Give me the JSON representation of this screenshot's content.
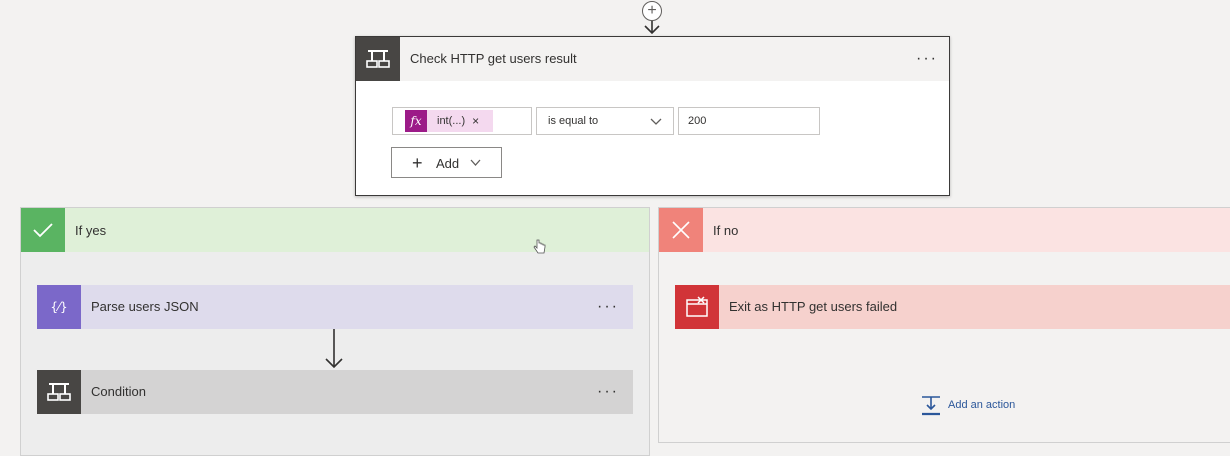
{
  "connector": {
    "plus_glyph": "+",
    "icon": "plus-circle-icon"
  },
  "condition_card": {
    "title": "Check HTTP get users result",
    "more_label": "···",
    "expression": {
      "fx_label": "fx",
      "token_text": "int(...)",
      "remove_label": "×"
    },
    "operator": {
      "selected": "is equal to"
    },
    "value": "200",
    "add_button": {
      "plus": "+",
      "label": "Add"
    }
  },
  "branches": {
    "yes": {
      "title": "If yes",
      "actions": [
        {
          "title": "Parse users JSON",
          "more_label": "···",
          "icon": "parse-json-icon",
          "color": "#7b68c9"
        },
        {
          "title": "Condition",
          "more_label": "···",
          "icon": "condition-icon",
          "color": "#484644"
        }
      ]
    },
    "no": {
      "title": "If no",
      "actions": [
        {
          "title": "Exit as HTTP get users failed",
          "icon": "terminate-icon",
          "color": "#d13438"
        }
      ],
      "add_action_label": "Add an action"
    }
  },
  "colors": {
    "yes_accent": "#5ab462",
    "no_accent": "#f0837a",
    "fx_token": "#9c1b88",
    "link": "#2b579a"
  }
}
